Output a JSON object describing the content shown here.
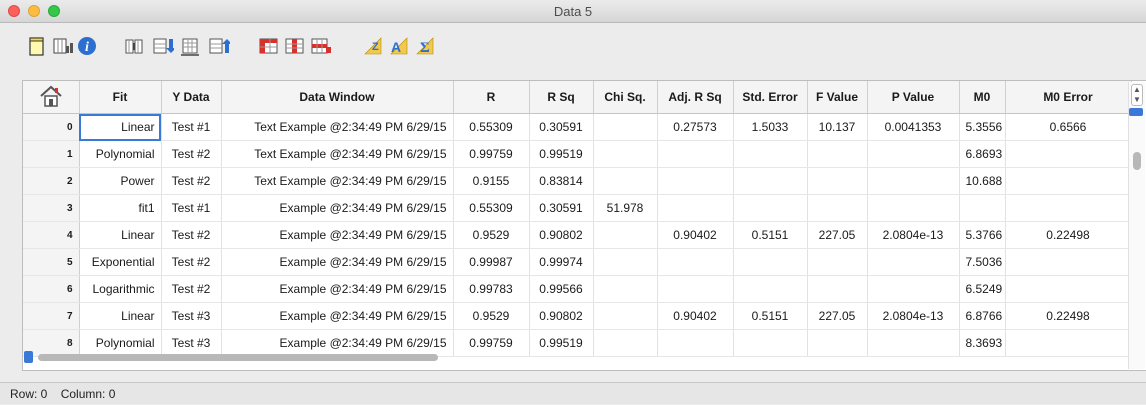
{
  "window": {
    "title": "Data 5"
  },
  "toolbar": {
    "buttons": [
      "new-sheet-icon",
      "plot-data-icon",
      "info-icon",
      "insert-columns-icon",
      "insert-rows-import-icon",
      "delete-columns-icon",
      "export-rows-icon",
      "red-grid-icon",
      "red-grid-columns-icon",
      "red-grid-rows-icon",
      "sort-z-icon",
      "sort-a-icon",
      "sum-icon"
    ]
  },
  "table": {
    "columns": [
      "Fit",
      "Y Data",
      "Data Window",
      "R",
      "R Sq",
      "Chi Sq.",
      "Adj. R Sq",
      "Std. Error",
      "F Value",
      "P Value",
      "M0",
      "M0 Error"
    ],
    "rows": [
      {
        "num": "0",
        "cells": [
          "Linear",
          "Test #1",
          "Text Example @2:34:49 PM 6/29/15",
          "0.55309",
          "0.30591",
          "",
          "0.27573",
          "1.5033",
          "10.137",
          "0.0041353",
          "5.3556",
          "0.6566"
        ]
      },
      {
        "num": "1",
        "cells": [
          "Polynomial",
          "Test #2",
          "Text Example @2:34:49 PM 6/29/15",
          "0.99759",
          "0.99519",
          "",
          "",
          "",
          "",
          "",
          "6.8693",
          ""
        ]
      },
      {
        "num": "2",
        "cells": [
          "Power",
          "Test #2",
          "Text Example @2:34:49 PM 6/29/15",
          "0.9155",
          "0.83814",
          "",
          "",
          "",
          "",
          "",
          "10.688",
          ""
        ]
      },
      {
        "num": "3",
        "cells": [
          "fit1",
          "Test #1",
          "Example @2:34:49 PM 6/29/15",
          "0.55309",
          "0.30591",
          "51.978",
          "",
          "",
          "",
          "",
          "",
          ""
        ]
      },
      {
        "num": "4",
        "cells": [
          "Linear",
          "Test #2",
          "Example @2:34:49 PM 6/29/15",
          "0.9529",
          "0.90802",
          "",
          "0.90402",
          "0.5151",
          "227.05",
          "2.0804e-13",
          "5.3766",
          "0.22498"
        ]
      },
      {
        "num": "5",
        "cells": [
          "Exponential",
          "Test #2",
          "Example @2:34:49 PM 6/29/15",
          "0.99987",
          "0.99974",
          "",
          "",
          "",
          "",
          "",
          "7.5036",
          ""
        ]
      },
      {
        "num": "6",
        "cells": [
          "Logarithmic",
          "Test #2",
          "Example @2:34:49 PM 6/29/15",
          "0.99783",
          "0.99566",
          "",
          "",
          "",
          "",
          "",
          "6.5249",
          ""
        ]
      },
      {
        "num": "7",
        "cells": [
          "Linear",
          "Test #3",
          "Example @2:34:49 PM 6/29/15",
          "0.9529",
          "0.90802",
          "",
          "0.90402",
          "0.5151",
          "227.05",
          "2.0804e-13",
          "6.8766",
          "0.22498"
        ]
      },
      {
        "num": "8",
        "cells": [
          "Polynomial",
          "Test #3",
          "Example @2:34:49 PM 6/29/15",
          "0.99759",
          "0.99519",
          "",
          "",
          "",
          "",
          "",
          "8.3693",
          ""
        ]
      }
    ]
  },
  "status": {
    "row": "Row: 0",
    "column": "Column: 0"
  },
  "colors": {
    "selection": "#3a79d8",
    "accent_red": "#d9302b",
    "accent_blue": "#2c6fd1"
  }
}
